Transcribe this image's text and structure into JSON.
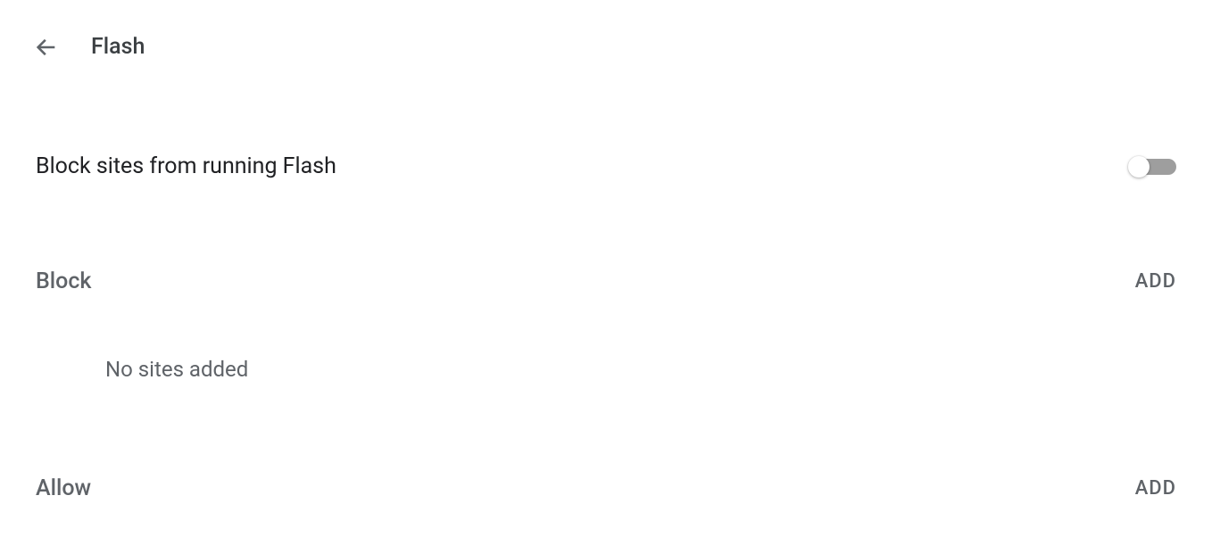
{
  "header": {
    "title": "Flash"
  },
  "mainToggle": {
    "label": "Block sites from running Flash",
    "enabled": false
  },
  "sections": {
    "block": {
      "title": "Block",
      "addLabel": "ADD",
      "emptyMessage": "No sites added"
    },
    "allow": {
      "title": "Allow",
      "addLabel": "ADD"
    }
  }
}
